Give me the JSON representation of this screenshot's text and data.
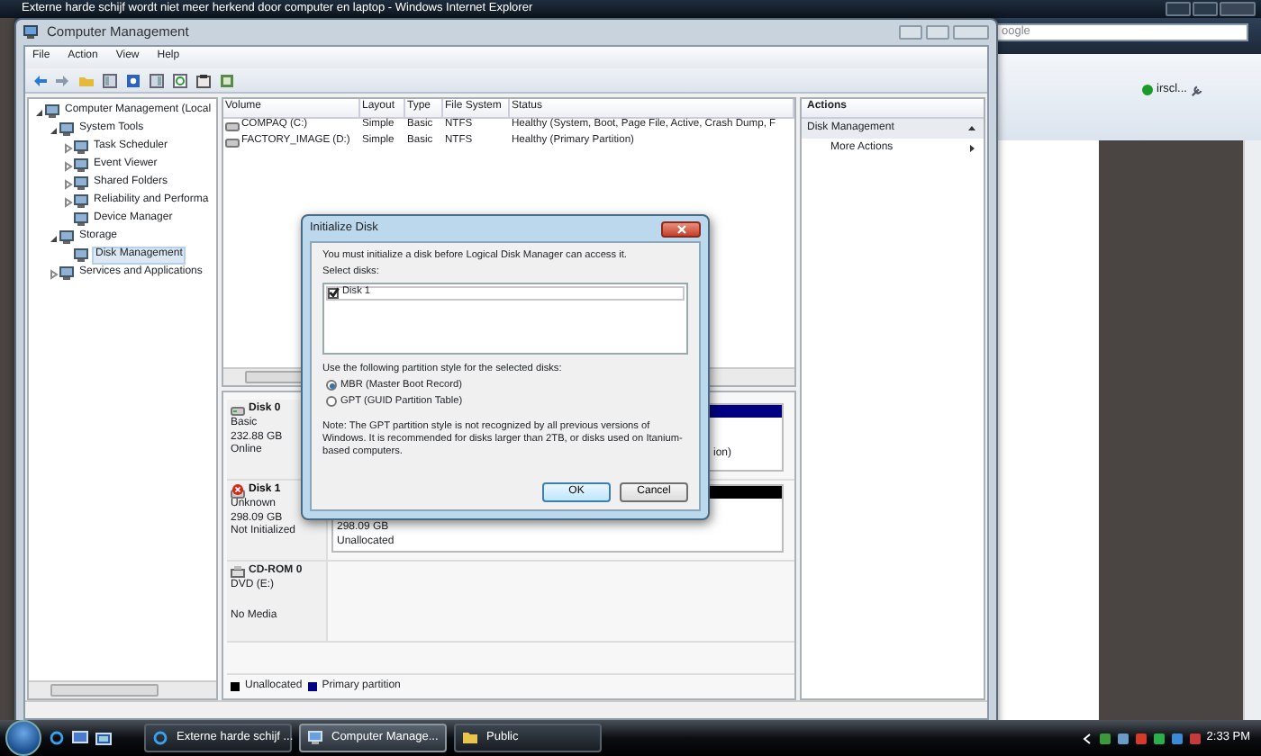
{
  "browser": {
    "title": "Externe harde schijf wordt niet meer herkend door computer en laptop - Windows Internet Explorer",
    "search_text": "oogle",
    "user_label": "irscl..."
  },
  "window": {
    "title": "Computer Management"
  },
  "menu": [
    "File",
    "Action",
    "View",
    "Help"
  ],
  "tree": [
    {
      "label": "Computer Management (Local",
      "expanded": true,
      "selected": false,
      "children": [
        {
          "label": "System Tools",
          "expanded": true,
          "selected": false,
          "children": [
            {
              "label": "Task Scheduler",
              "expanded": false,
              "selected": false
            },
            {
              "label": "Event Viewer",
              "expanded": false,
              "selected": false
            },
            {
              "label": "Shared Folders",
              "expanded": false,
              "selected": false
            },
            {
              "label": "Reliability and Performa",
              "expanded": false,
              "selected": false
            },
            {
              "label": "Device Manager",
              "selected": false
            }
          ]
        },
        {
          "label": "Storage",
          "expanded": true,
          "selected": false,
          "children": [
            {
              "label": "Disk Management",
              "selected": true
            }
          ]
        },
        {
          "label": "Services and Applications",
          "expanded": false,
          "selected": false
        }
      ]
    }
  ],
  "volumes": {
    "columns": [
      "Volume",
      "Layout",
      "Type",
      "File System",
      "Status"
    ],
    "rows": [
      [
        "COMPAQ (C:)",
        "Simple",
        "Basic",
        "NTFS",
        "Healthy (System, Boot, Page File, Active, Crash Dump, F"
      ],
      [
        "FACTORY_IMAGE (D:)",
        "Simple",
        "Basic",
        "NTFS",
        "Healthy (Primary Partition)"
      ]
    ]
  },
  "disks": [
    {
      "name": "Disk 0",
      "kind": "disk",
      "error": false,
      "lines": [
        "Basic",
        "232.88 GB",
        "Online"
      ],
      "partition": {
        "color": "#000080",
        "lines": [
          "ion)"
        ]
      }
    },
    {
      "name": "Disk 1",
      "kind": "disk",
      "error": true,
      "lines": [
        "Unknown",
        "298.09 GB",
        "Not Initialized"
      ],
      "partition": {
        "color": "#000000",
        "lines": [
          "298.09 GB",
          "Unallocated"
        ]
      }
    },
    {
      "name": "CD-ROM 0",
      "kind": "cdrom",
      "lines": [
        "DVD (E:)",
        "No Media"
      ]
    }
  ],
  "legend": [
    {
      "label": "Unallocated",
      "color": "#000000"
    },
    {
      "label": "Primary partition",
      "color": "#000080"
    }
  ],
  "actions": {
    "title": "Actions",
    "items": [
      {
        "label": "Disk Management",
        "kind": "header"
      },
      {
        "label": "More Actions",
        "kind": "item"
      }
    ]
  },
  "dialog": {
    "title": "Initialize Disk",
    "intro": "You must initialize a disk before Logical Disk Manager can access it.",
    "select_label": "Select disks:",
    "disks": [
      {
        "label": "Disk 1",
        "checked": true
      }
    ],
    "style_label": "Use the following partition style for the selected disks:",
    "options": [
      {
        "label": "MBR (Master Boot Record)",
        "selected": true
      },
      {
        "label": "GPT (GUID Partition Table)",
        "selected": false
      }
    ],
    "note": "Note: The GPT partition style is not recognized by all previous versions of Windows. It is recommended for disks larger than 2TB, or disks used on Itanium-based computers.",
    "buttons": [
      {
        "label": "OK",
        "default": true
      },
      {
        "label": "Cancel",
        "default": false
      }
    ]
  },
  "taskbar": {
    "buttons": [
      {
        "label": "Externe harde schijf ...",
        "kind": "browser",
        "selected": false
      },
      {
        "label": "Computer Manage...",
        "kind": "management",
        "selected": true
      },
      {
        "label": "Public",
        "kind": "folder",
        "selected": false
      }
    ],
    "clock": "2:33 PM"
  }
}
